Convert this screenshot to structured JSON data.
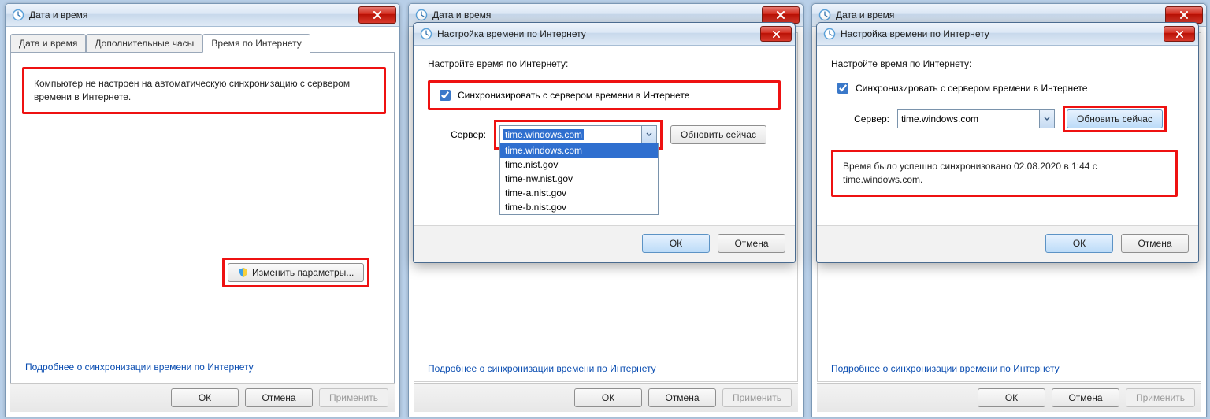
{
  "main_title": "Дата и время",
  "tabs": [
    "Дата и время",
    "Дополнительные часы",
    "Время по Интернету"
  ],
  "active_tab_index": 2,
  "not_configured_text": "Компьютер не настроен на автоматическую синхронизацию с сервером времени в Интернете.",
  "change_params_label": "Изменить параметры...",
  "learn_more_link": "Подробнее о синхронизации времени по Интернету",
  "ok_label": "ОК",
  "cancel_label": "Отмена",
  "apply_label": "Применить",
  "modal": {
    "title": "Настройка времени по Интернету",
    "instruction": "Настройте время по Интернету:",
    "sync_checkbox_label": "Синхронизировать с сервером времени в Интернете",
    "sync_checked": true,
    "server_label": "Сервер:",
    "server_selected": "time.windows.com",
    "server_options": [
      "time.windows.com",
      "time.nist.gov",
      "time-nw.nist.gov",
      "time-a.nist.gov",
      "time-b.nist.gov"
    ],
    "update_now_label": "Обновить сейчас",
    "success_message": "Время было успешно синхронизовано 02.08.2020 в 1:44 c time.windows.com."
  }
}
